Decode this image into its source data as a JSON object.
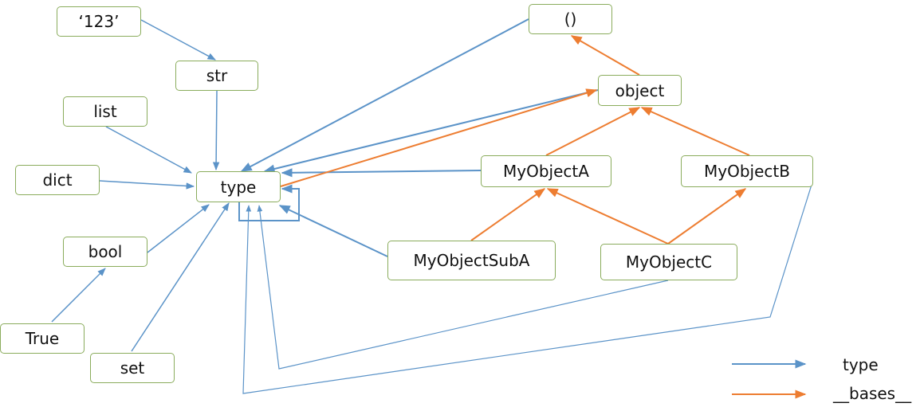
{
  "diagram": {
    "nodes": [
      {
        "id": "str123",
        "label": "‘123’"
      },
      {
        "id": "str",
        "label": "str"
      },
      {
        "id": "list",
        "label": "list"
      },
      {
        "id": "dict",
        "label": "dict"
      },
      {
        "id": "type",
        "label": "type"
      },
      {
        "id": "bool",
        "label": "bool"
      },
      {
        "id": "true",
        "label": "True"
      },
      {
        "id": "set",
        "label": "set"
      },
      {
        "id": "tuple",
        "label": "()"
      },
      {
        "id": "object",
        "label": "object"
      },
      {
        "id": "myobja",
        "label": "MyObjectA"
      },
      {
        "id": "myobjb",
        "label": "MyObjectB"
      },
      {
        "id": "myobjsuba",
        "label": "MyObjectSubA"
      },
      {
        "id": "myobjc",
        "label": "MyObjectC"
      }
    ],
    "edges": [
      {
        "from": "str123",
        "to": "str",
        "kind": "type"
      },
      {
        "from": "str",
        "to": "type",
        "kind": "type"
      },
      {
        "from": "list",
        "to": "type",
        "kind": "type"
      },
      {
        "from": "dict",
        "to": "type",
        "kind": "type"
      },
      {
        "from": "bool",
        "to": "type",
        "kind": "type"
      },
      {
        "from": "true",
        "to": "bool",
        "kind": "type"
      },
      {
        "from": "set",
        "to": "type",
        "kind": "type"
      },
      {
        "from": "tuple",
        "to": "type",
        "kind": "type"
      },
      {
        "from": "object",
        "to": "type",
        "kind": "type"
      },
      {
        "from": "type",
        "to": "type",
        "kind": "type"
      },
      {
        "from": "myobja",
        "to": "type",
        "kind": "type"
      },
      {
        "from": "myobjsuba",
        "to": "type",
        "kind": "type"
      },
      {
        "from": "myobjc",
        "to": "type",
        "kind": "type"
      },
      {
        "from": "myobjb",
        "to": "type",
        "kind": "type"
      },
      {
        "from": "object",
        "to": "tuple",
        "kind": "bases"
      },
      {
        "from": "type",
        "to": "object",
        "kind": "bases"
      },
      {
        "from": "myobja",
        "to": "object",
        "kind": "bases"
      },
      {
        "from": "myobjb",
        "to": "object",
        "kind": "bases"
      },
      {
        "from": "myobjsuba",
        "to": "myobja",
        "kind": "bases"
      },
      {
        "from": "myobjc",
        "to": "myobja",
        "kind": "bases"
      },
      {
        "from": "myobjc",
        "to": "myobjb",
        "kind": "bases"
      }
    ]
  },
  "legend": [
    {
      "kind": "type",
      "label": "type"
    },
    {
      "kind": "bases",
      "label": "__bases__"
    }
  ],
  "colors": {
    "type_edge": "#5b93c8",
    "bases_edge": "#ed7d31",
    "node_border": "#8aac5c"
  }
}
